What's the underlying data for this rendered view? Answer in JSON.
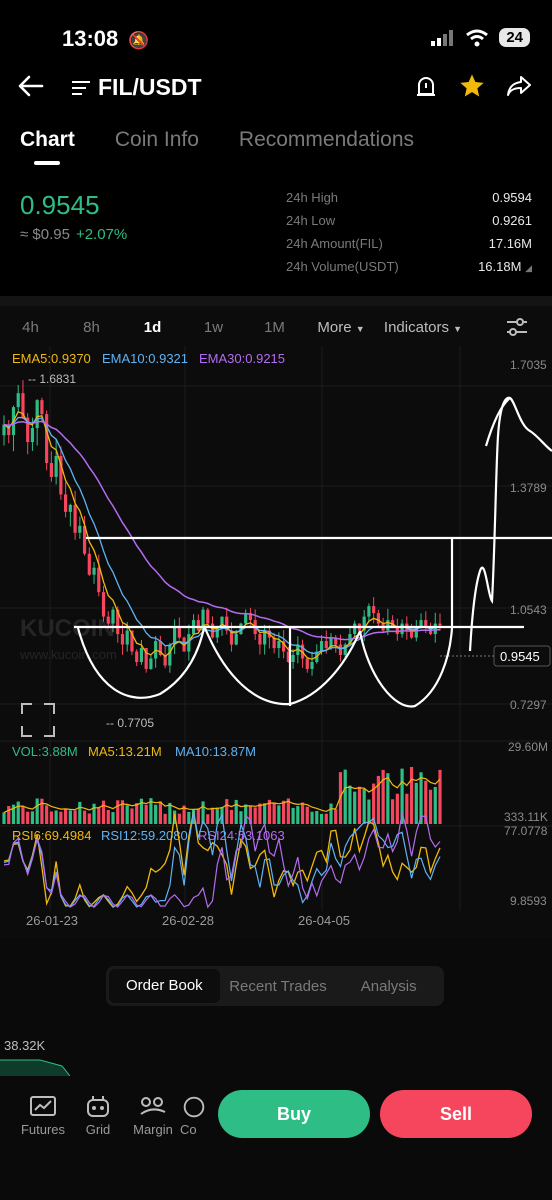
{
  "status_bar": {
    "time": "13:08",
    "battery": "24"
  },
  "header": {
    "pair": "FIL/USDT"
  },
  "tabs": [
    {
      "label": "Chart",
      "active": true
    },
    {
      "label": "Coin Info",
      "active": false
    },
    {
      "label": "Recommendations",
      "active": false
    }
  ],
  "ticker": {
    "last_price": "0.9545",
    "fiat_price": "≈ $0.95",
    "change": "+2.07%",
    "stats": [
      {
        "label": "24h High",
        "value": "0.9594"
      },
      {
        "label": "24h Low",
        "value": "0.9261"
      },
      {
        "label": "24h Amount(FIL)",
        "value": "17.16M"
      },
      {
        "label": "24h Volume(USDT)",
        "value": "16.18M"
      }
    ]
  },
  "timeframes": {
    "items": [
      "4h",
      "8h",
      "1d",
      "1w",
      "1M"
    ],
    "active": "1d",
    "more": "More",
    "indicators": "Indicators"
  },
  "chart_data": {
    "type": "candlestick",
    "price_axis_labels": [
      "1.7035",
      "1.3789",
      "1.0543",
      "0.7297"
    ],
    "current_price_tag": "0.9545",
    "max_marker": "1.6831",
    "min_marker": "0.7705",
    "ema_legend": [
      {
        "label": "EMA5:0.9370",
        "color": "#f0b90b"
      },
      {
        "label": "EMA10:0.9321",
        "color": "#5fb3f5"
      },
      {
        "label": "EMA30:0.9215",
        "color": "#b46cf0"
      }
    ],
    "volume_legend": [
      {
        "label": "VOL:3.88M",
        "color": "#2ebd85"
      },
      {
        "label": "MA5:13.21M",
        "color": "#f0b90b"
      },
      {
        "label": "MA10:13.87M",
        "color": "#5fb3f5"
      }
    ],
    "volume_axis_labels": [
      "29.60M",
      "333.11K"
    ],
    "rsi_legend": [
      {
        "label": "RSI6:69.4984",
        "color": "#f0b90b"
      },
      {
        "label": "RSI12:59.2080",
        "color": "#5fb3f5"
      },
      {
        "label": "RSI24:53.1063",
        "color": "#b46cf0"
      }
    ],
    "rsi_axis_labels": [
      "77.0778",
      "9.8593"
    ],
    "date_labels": [
      "26-01-23",
      "26-02-28",
      "26-04-05"
    ],
    "watermark": "KUCOIN",
    "watermark_url": "www.kucoin.com",
    "colors": {
      "up": "#2ebd85",
      "down": "#f6465d"
    },
    "close_prices": [
      1.53,
      1.5,
      1.58,
      1.62,
      1.55,
      1.48,
      1.52,
      1.6,
      1.56,
      1.42,
      1.38,
      1.44,
      1.33,
      1.28,
      1.3,
      1.22,
      1.24,
      1.16,
      1.1,
      1.12,
      1.05,
      0.98,
      0.96,
      1.0,
      0.93,
      0.9,
      0.94,
      0.88,
      0.85,
      0.89,
      0.83,
      0.86,
      0.91,
      0.87,
      0.84,
      0.9,
      0.95,
      0.92,
      0.88,
      0.93,
      0.97,
      0.94,
      1.0,
      0.96,
      0.92,
      0.95,
      0.98,
      0.94,
      0.9,
      0.93,
      0.96,
      0.99,
      0.97,
      0.93,
      0.9,
      0.94,
      0.92,
      0.89,
      0.91,
      0.88,
      0.85,
      0.87,
      0.9,
      0.86,
      0.83,
      0.85,
      0.88,
      0.91,
      0.89,
      0.92,
      0.9,
      0.87,
      0.9,
      0.93,
      0.96,
      0.94,
      0.98,
      1.01,
      0.99,
      0.96,
      0.94,
      0.97,
      0.95,
      0.93,
      0.96,
      0.94,
      0.92,
      0.95,
      0.97,
      0.95,
      0.93,
      0.96,
      0.9545
    ]
  },
  "lower_tabs": [
    {
      "label": "Order Book",
      "active": true
    },
    {
      "label": "Recent Trades",
      "active": false
    },
    {
      "label": "Analysis",
      "active": false
    }
  ],
  "order_book_value": "38.32K",
  "bottom_nav": [
    {
      "label": "Futures",
      "icon": "futures-icon"
    },
    {
      "label": "Grid",
      "icon": "grid-bot-icon"
    },
    {
      "label": "Margin",
      "icon": "margin-icon"
    },
    {
      "label": "Co",
      "icon": "copy-trading-icon"
    }
  ],
  "actions": {
    "buy": "Buy",
    "sell": "Sell"
  }
}
